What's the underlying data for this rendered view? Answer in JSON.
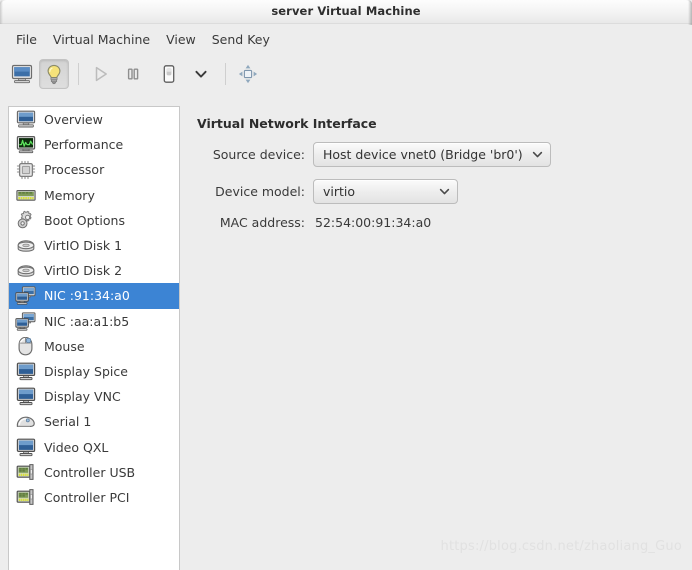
{
  "window": {
    "title": "server Virtual Machine"
  },
  "menubar": {
    "items": [
      {
        "label": "File",
        "name": "menu-file"
      },
      {
        "label": "Virtual Machine",
        "name": "menu-virtual-machine"
      },
      {
        "label": "View",
        "name": "menu-view"
      },
      {
        "label": "Send Key",
        "name": "menu-send-key"
      }
    ]
  },
  "toolbar": {
    "buttons": [
      {
        "icon": "monitor-console-icon",
        "name": "show-console-button",
        "pressed": false,
        "enabled": true
      },
      {
        "icon": "lightbulb-details-icon",
        "name": "show-details-button",
        "pressed": true,
        "enabled": true
      },
      {
        "icon": "play-icon",
        "name": "run-vm-button",
        "pressed": false,
        "enabled": false
      },
      {
        "icon": "pause-icon",
        "name": "pause-vm-button",
        "pressed": false,
        "enabled": true
      },
      {
        "icon": "power-shutdown-icon",
        "name": "shutdown-vm-button",
        "pressed": false,
        "enabled": true
      },
      {
        "icon": "chevron-down-icon",
        "name": "shutdown-options-dropdown",
        "pressed": false,
        "enabled": true
      },
      {
        "icon": "fullscreen-arrows-icon",
        "name": "fullscreen-button",
        "pressed": false,
        "enabled": true
      }
    ]
  },
  "sidebar": {
    "items": [
      {
        "label": "Overview",
        "icon": "monitor-icon",
        "name": "sidebar-item-overview",
        "selected": false
      },
      {
        "label": "Performance",
        "icon": "graph-icon",
        "name": "sidebar-item-performance",
        "selected": false
      },
      {
        "label": "Processor",
        "icon": "cpu-chip-icon",
        "name": "sidebar-item-processor",
        "selected": false
      },
      {
        "label": "Memory",
        "icon": "memory-ram-icon",
        "name": "sidebar-item-memory",
        "selected": false
      },
      {
        "label": "Boot Options",
        "icon": "gears-icon",
        "name": "sidebar-item-boot-options",
        "selected": false
      },
      {
        "label": "VirtIO Disk 1",
        "icon": "harddisk-icon",
        "name": "sidebar-item-virtio-disk-1",
        "selected": false
      },
      {
        "label": "VirtIO Disk 2",
        "icon": "harddisk-icon",
        "name": "sidebar-item-virtio-disk-2",
        "selected": false
      },
      {
        "label": "NIC :91:34:a0",
        "icon": "network-card-icon",
        "name": "sidebar-item-nic-91-34-a0",
        "selected": true
      },
      {
        "label": "NIC :aa:a1:b5",
        "icon": "network-card-icon",
        "name": "sidebar-item-nic-aa-a1-b5",
        "selected": false
      },
      {
        "label": "Mouse",
        "icon": "mouse-icon",
        "name": "sidebar-item-mouse",
        "selected": false
      },
      {
        "label": "Display Spice",
        "icon": "display-icon",
        "name": "sidebar-item-display-spice",
        "selected": false
      },
      {
        "label": "Display VNC",
        "icon": "display-icon",
        "name": "sidebar-item-display-vnc",
        "selected": false
      },
      {
        "label": "Serial 1",
        "icon": "serial-port-icon",
        "name": "sidebar-item-serial-1",
        "selected": false
      },
      {
        "label": "Video QXL",
        "icon": "display-icon",
        "name": "sidebar-item-video-qxl",
        "selected": false
      },
      {
        "label": "Controller USB",
        "icon": "controller-card-icon",
        "name": "sidebar-item-controller-usb",
        "selected": false
      },
      {
        "label": "Controller PCI",
        "icon": "controller-card-icon",
        "name": "sidebar-item-controller-pci",
        "selected": false
      }
    ]
  },
  "detail": {
    "title": "Virtual Network Interface",
    "source_device": {
      "label": "Source device:",
      "value": "Host device vnet0 (Bridge 'br0')"
    },
    "device_model": {
      "label": "Device model:",
      "value": "virtio"
    },
    "mac_address": {
      "label": "MAC address:",
      "value": "52:54:00:91:34:a0"
    }
  },
  "watermark": {
    "text": "https://blog.csdn.net/zhaoliang_Guo"
  },
  "colors": {
    "selection_blue": "#3c84d4",
    "window_bg": "#ededed",
    "list_bg": "#ffffff",
    "text": "#3a3a3a"
  }
}
